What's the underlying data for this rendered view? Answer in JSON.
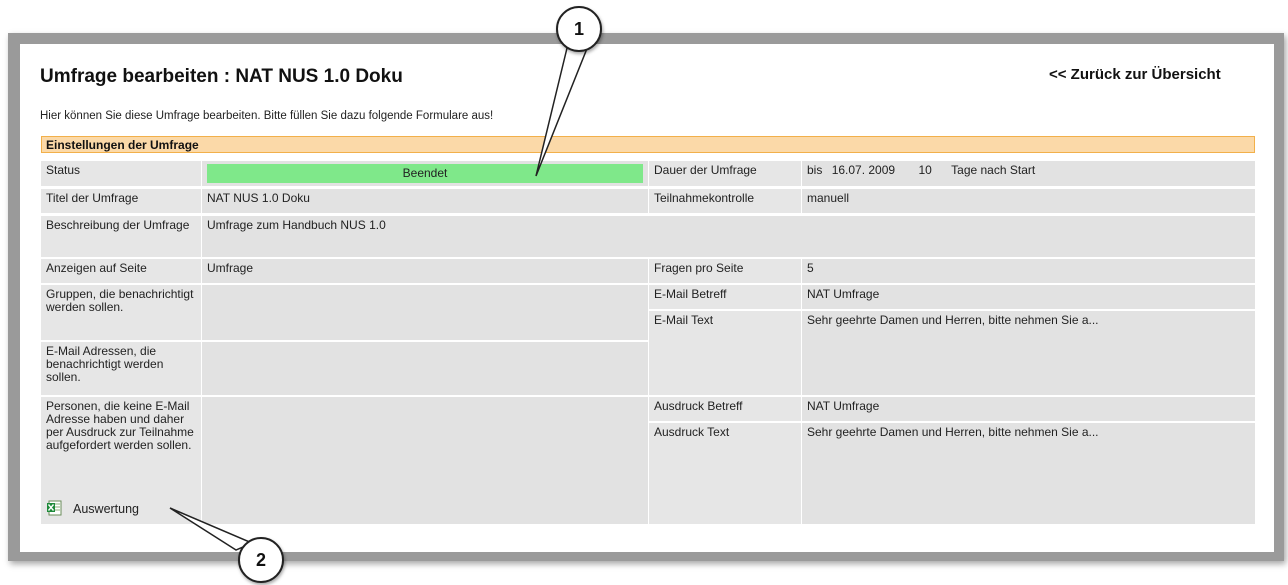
{
  "page": {
    "title": "Umfrage bearbeiten : NAT NUS 1.0 Doku",
    "back_link": "<< Zurück zur Übersicht",
    "intro": "Hier können Sie diese Umfrage bearbeiten. Bitte füllen Sie dazu folgende Formulare aus!"
  },
  "settings": {
    "header": "Einstellungen der Umfrage",
    "status_label": "Status",
    "status_value": "Beendet",
    "dauer_label": "Dauer der Umfrage",
    "dauer_bis": "bis",
    "dauer_date": "16.07. 2009",
    "dauer_days": "10",
    "dauer_suffix": "Tage nach Start",
    "titel_label": "Titel der Umfrage",
    "titel_value": "NAT NUS 1.0 Doku",
    "teilnahme_label": "Teilnahmekontrolle",
    "teilnahme_value": "manuell",
    "beschreibung_label": "Beschreibung der Umfrage",
    "beschreibung_value": "Umfrage zum Handbuch NUS 1.0",
    "anzeigen_label": "Anzeigen auf Seite",
    "anzeigen_value": "Umfrage",
    "fragen_label": "Fragen pro Seite",
    "fragen_value": "5",
    "gruppen_label": "Gruppen, die benachrichtigt werden sollen.",
    "email_betreff_label": "E-Mail Betreff",
    "email_betreff_value": "NAT Umfrage",
    "email_text_label": "E-Mail Text",
    "email_text_value": "Sehr geehrte Damen und Herren, bitte nehmen Sie a...",
    "email_adressen_label": "E-Mail Adressen, die benachrichtigt werden sollen.",
    "personen_label": "Personen, die keine E-Mail Adresse haben und daher per Ausdruck zur Teilnahme aufgefordert werden sollen.",
    "ausdruck_betreff_label": "Ausdruck Betreff",
    "ausdruck_betreff_value": "NAT Umfrage",
    "ausdruck_text_label": "Ausdruck Text",
    "ausdruck_text_value": "Sehr geehrte Damen und Herren, bitte nehmen Sie a...",
    "auswertung_label": "Auswertung"
  },
  "callouts": {
    "one": "1",
    "two": "2"
  },
  "icons": {
    "excel": "excel-file-icon"
  },
  "colors": {
    "status_green": "#7fe88a",
    "header_orange": "#fbd9a8",
    "cell_gray": "#e2e2e2"
  }
}
